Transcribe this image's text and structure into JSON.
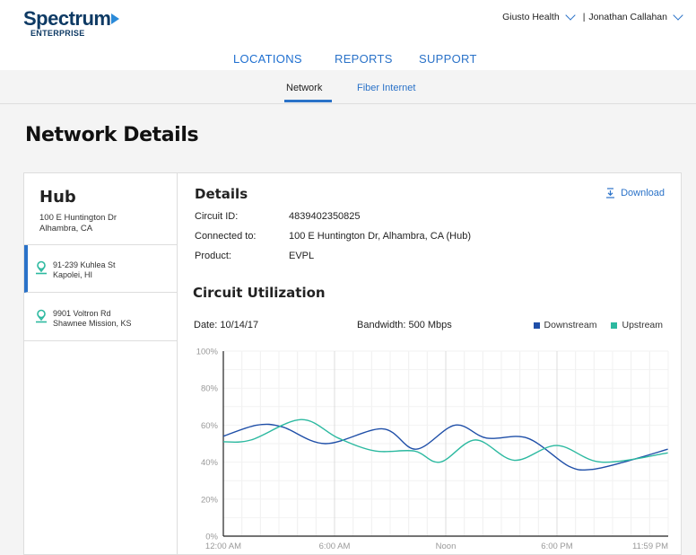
{
  "brand": {
    "name": "Spectrum",
    "sub": "ENTERPRISE"
  },
  "header": {
    "org": "Giusto Health",
    "separator": "|",
    "user": "Jonathan Callahan"
  },
  "mainnav": [
    "LOCATIONS",
    "REPORTS",
    "SUPPORT"
  ],
  "subnav": {
    "network": "Network",
    "fiber": "Fiber Internet"
  },
  "page": {
    "title": "Network Details"
  },
  "sidebar": {
    "hub_title": "Hub",
    "hub_addr1": "100 E Huntington Dr",
    "hub_addr2": "Alhambra, CA",
    "locations": [
      {
        "line1": "91-239 Kuhlea St",
        "line2": "Kapolei, HI"
      },
      {
        "line1": "9901 Voltron Rd",
        "line2": "Shawnee Mission, KS"
      }
    ]
  },
  "details": {
    "title": "Details",
    "download": "Download",
    "rows": [
      {
        "key": "Circuit ID:",
        "value": "4839402350825"
      },
      {
        "key": "Connected to:",
        "value": "100 E Huntington Dr, Alhambra, CA (Hub)"
      },
      {
        "key": "Product:",
        "value": "EVPL"
      }
    ]
  },
  "utilization": {
    "title": "Circuit Utilization",
    "date": "Date: 10/14/17",
    "bandwidth": "Bandwidth: 500 Mbps"
  },
  "colors": {
    "downstream": "#1f4fa8",
    "upstream": "#2cb9a0",
    "accent": "#2a72c8"
  },
  "chart_data": {
    "type": "line",
    "x": [
      "12:00 AM",
      "6:00 AM",
      "Noon",
      "6:00 PM",
      "11:59 PM"
    ],
    "yticks": [
      "100%",
      "80%",
      "60%",
      "40%",
      "20%",
      "0%"
    ],
    "ylim": [
      0,
      100
    ],
    "legend": "top-right",
    "grid": true,
    "series": [
      {
        "name": "Downstream",
        "hours": [
          0,
          1.8,
          3.2,
          5.5,
          8.6,
          10.4,
          12.5,
          14.2,
          16.4,
          18.6,
          19.8,
          21.6,
          23.98
        ],
        "values": [
          54,
          60,
          59,
          50,
          58,
          47,
          60,
          53,
          53,
          38,
          36,
          40,
          47
        ]
      },
      {
        "name": "Upstream",
        "hours": [
          0,
          1.5,
          4.2,
          6.2,
          8.2,
          10.3,
          11.7,
          13.6,
          15.7,
          18.0,
          20.4,
          23.98
        ],
        "values": [
          51,
          52,
          63,
          53,
          46,
          46,
          40,
          52,
          41,
          49,
          40,
          45
        ]
      }
    ]
  }
}
